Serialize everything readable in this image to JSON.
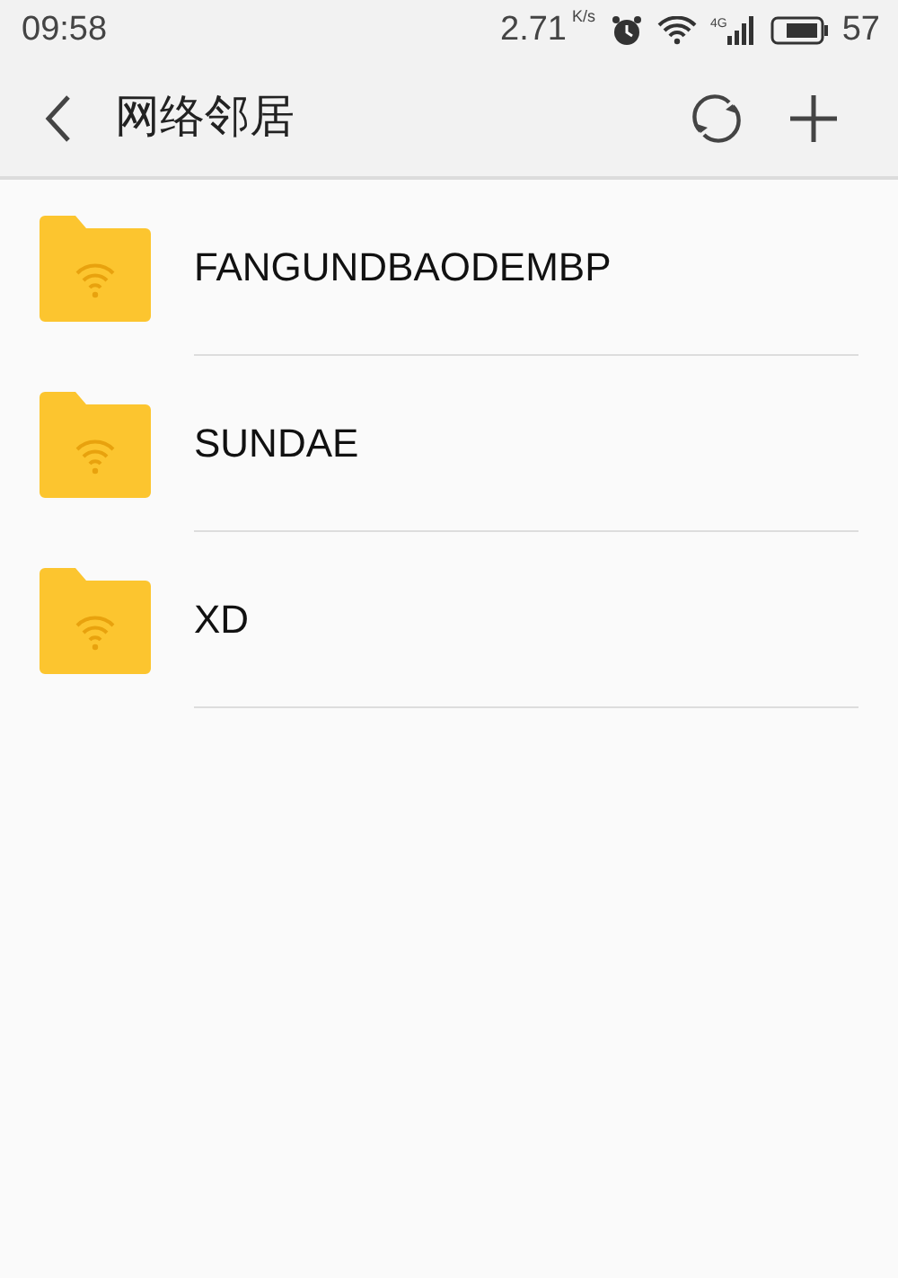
{
  "status_bar": {
    "time": "09:58",
    "speed": "2.71",
    "speed_unit": "K/s",
    "network": "4G",
    "battery": "57"
  },
  "toolbar": {
    "title": "网络邻居"
  },
  "items": [
    {
      "name": "FANGUNDBAODEMBP"
    },
    {
      "name": "SUNDAE"
    },
    {
      "name": "XD"
    }
  ]
}
